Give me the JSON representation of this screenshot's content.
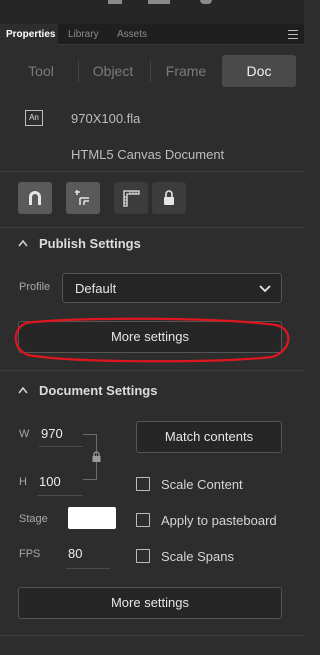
{
  "panel_tabs": [
    {
      "label": "Properties"
    },
    {
      "label": "Library"
    },
    {
      "label": "Assets"
    }
  ],
  "segments": [
    {
      "label": "Tool"
    },
    {
      "label": "Object"
    },
    {
      "label": "Frame"
    },
    {
      "label": "Doc"
    }
  ],
  "document": {
    "file_icon": "An",
    "file_name": "970X100.fla",
    "doc_type": "HTML5 Canvas Document"
  },
  "tool_buttons": [
    {
      "icon": "magnet-icon",
      "selected": true
    },
    {
      "icon": "snap-align-icon",
      "selected": true
    },
    {
      "icon": "ruler-icon",
      "selected": false
    },
    {
      "icon": "lock-icon",
      "selected": false
    }
  ],
  "publish": {
    "heading": "Publish Settings",
    "profile_label": "Profile",
    "profile_value": "Default",
    "more_settings": "More settings"
  },
  "doc_settings": {
    "heading": "Document Settings",
    "w_label": "W",
    "w_value": "970",
    "h_label": "H",
    "h_value": "100",
    "stage_label": "Stage",
    "stage_color": "#ffffff",
    "fps_label": "FPS",
    "fps_value": "80",
    "match_contents": "Match contents",
    "scale_content": "Scale Content",
    "apply_pasteboard": "Apply to pasteboard",
    "scale_spans": "Scale Spans",
    "more_settings": "More settings"
  },
  "colors": {
    "annotation": "#e0161f",
    "panel_bg": "#2d2d2d"
  }
}
